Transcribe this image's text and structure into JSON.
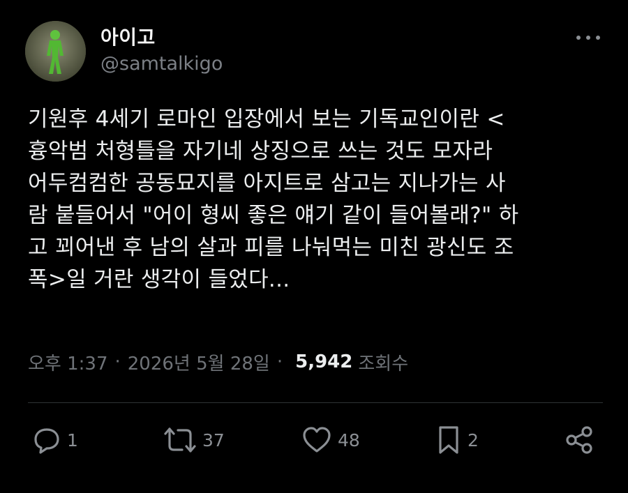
{
  "header": {
    "display_name": "아이고",
    "handle": "@samtalkigo",
    "more_icon": "more-horizontal-icon"
  },
  "tweet": {
    "lines": [
      "기원후 4세기 로마인 입장에서 보는 기독교인이란 <",
      "흉악범 처형틀을 자기네 상징으로 쓰는 것도 모자라",
      "어두컴컴한 공동묘지를 아지트로 삼고는 지나가는 사",
      "람 붙들어서 \"어이 형씨 좋은 얘기 같이 들어볼래?\" 하",
      "고 꾀어낸 후 남의 살과 피를 나눠먹는 미친 광신도 조",
      "폭>일 거란 생각이 들었다..."
    ]
  },
  "meta": {
    "time": "오후 1:37",
    "separator": "·",
    "date": "2026년 5월 28일",
    "views": "5,942",
    "views_label": "조회수"
  },
  "actions": {
    "reply": {
      "icon": "reply-icon",
      "count": "1"
    },
    "repost": {
      "icon": "repost-icon",
      "count": "37"
    },
    "like": {
      "icon": "heart-icon",
      "count": "48"
    },
    "bookmark": {
      "icon": "bookmark-icon",
      "count": "2"
    },
    "share": {
      "icon": "share-icon"
    }
  },
  "colors": {
    "background": "#000000",
    "text": "#eceeef",
    "muted": "#7c8086",
    "divider": "#2f3336"
  }
}
